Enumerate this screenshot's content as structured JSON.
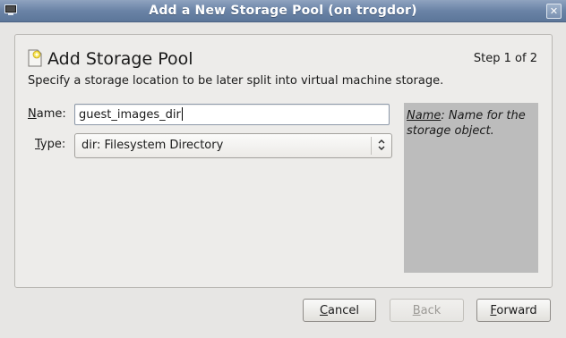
{
  "window": {
    "title": "Add a New Storage Pool (on trogdor)",
    "close_icon": "close-icon",
    "app_icon": "window-menu-icon"
  },
  "header": {
    "title": "Add Storage Pool",
    "icon": "storage-pool-icon",
    "step": "Step 1 of 2",
    "description": "Specify a storage location to be later split into virtual machine storage."
  },
  "form": {
    "name_label_mnemonic": "N",
    "name_label_rest": "ame:",
    "name_value": "guest_images_dir",
    "type_label_mnemonic": "T",
    "type_label_rest": "ype:",
    "type_selected": "dir: Filesystem Directory"
  },
  "help": {
    "term": "Name",
    "text": ": Name for the storage object."
  },
  "buttons": {
    "cancel_mnemonic": "C",
    "cancel_rest": "ancel",
    "back_mnemonic": "B",
    "back_rest": "ack",
    "forward_mnemonic": "F",
    "forward_rest": "orward"
  },
  "colors": {
    "titlebar": "#6a83a6",
    "help_panel": "#bcbcbc",
    "background": "#e7e6e4"
  }
}
